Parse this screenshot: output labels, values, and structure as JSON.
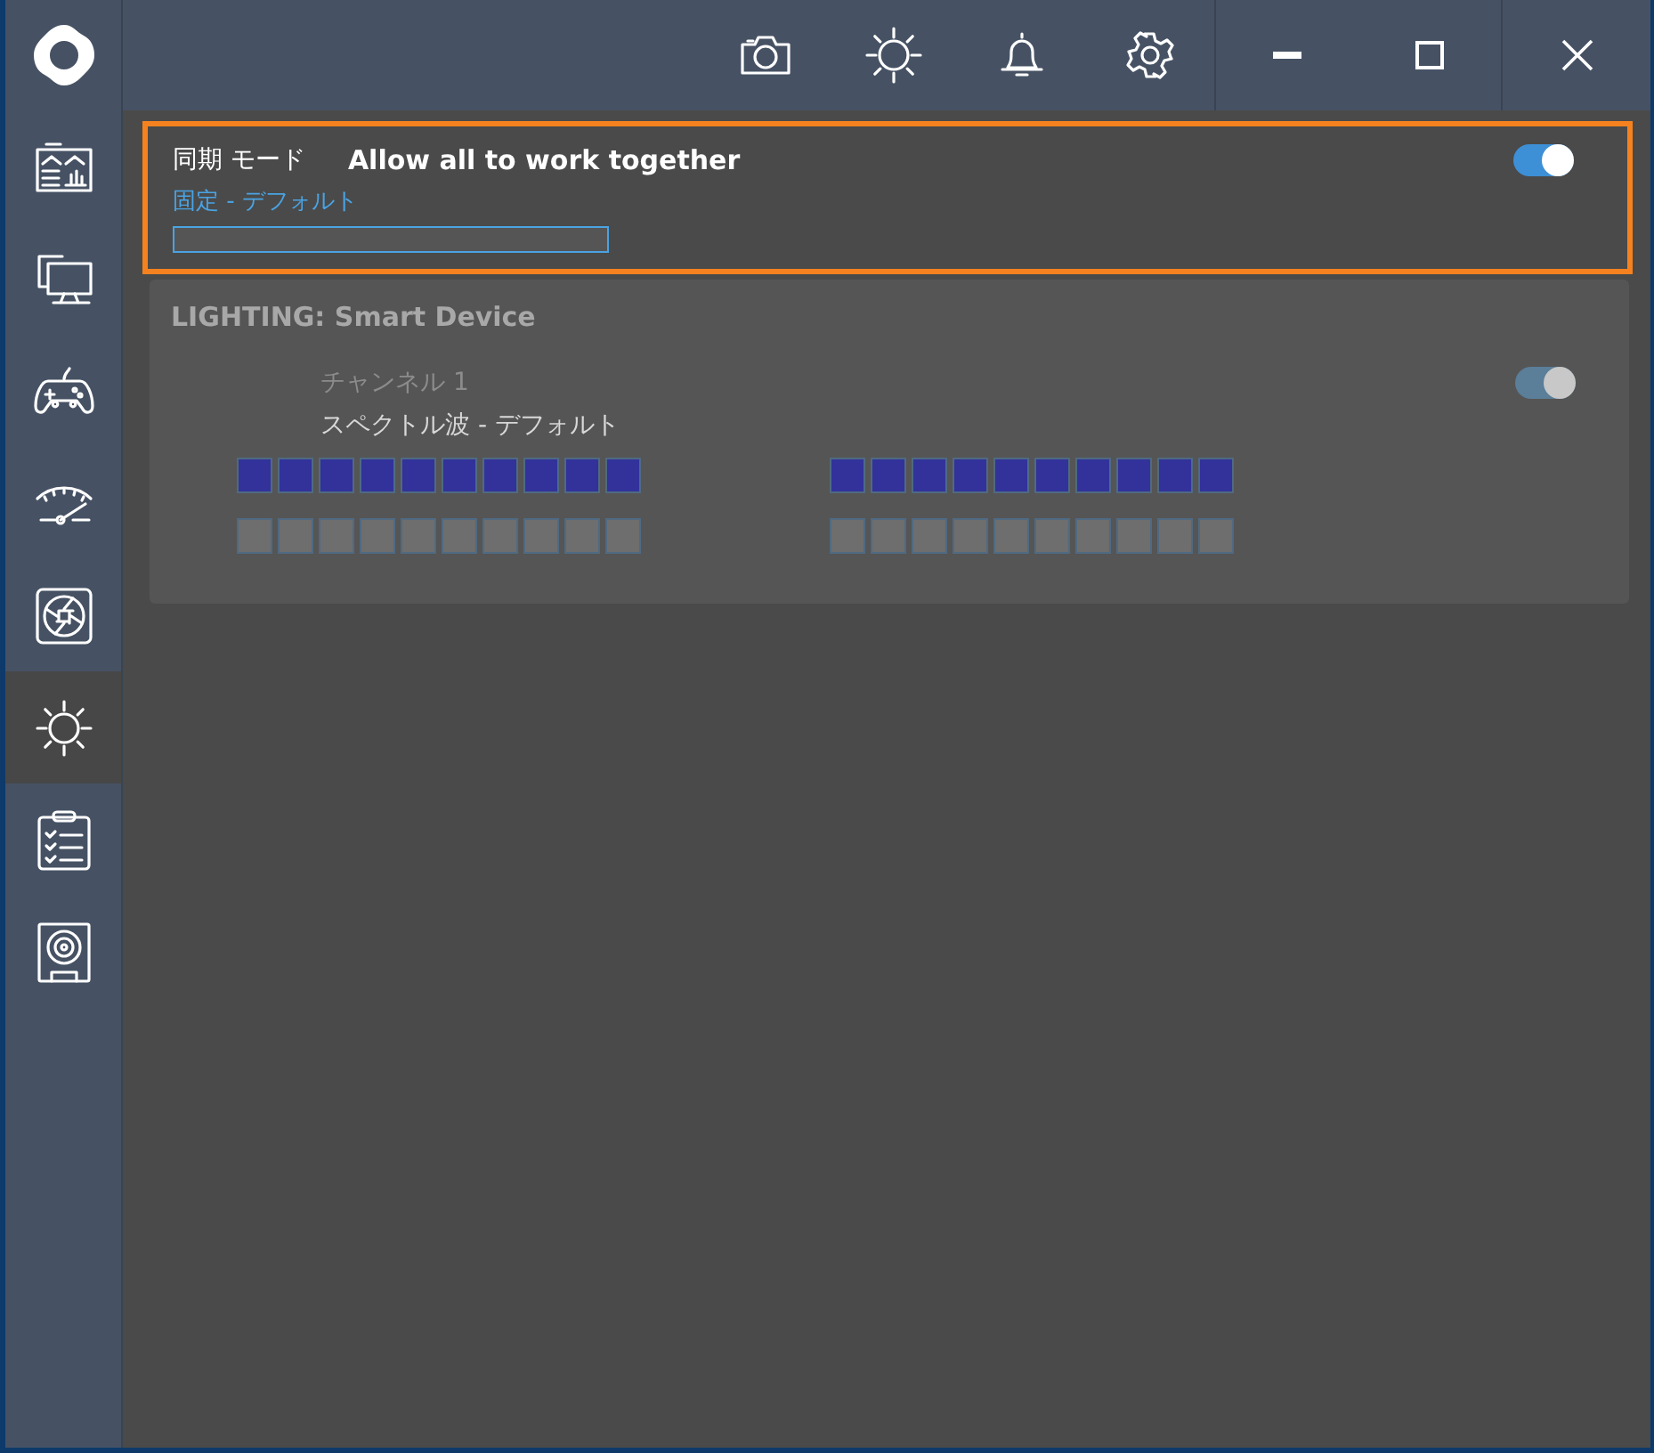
{
  "sidebar": {
    "items": [
      {
        "kind": "dashboard",
        "selected": false
      },
      {
        "kind": "monitor",
        "selected": false
      },
      {
        "kind": "gamepad",
        "selected": false
      },
      {
        "kind": "gauge",
        "selected": false
      },
      {
        "kind": "fan",
        "selected": false
      },
      {
        "kind": "sun",
        "selected": true
      },
      {
        "kind": "checklist",
        "selected": false
      },
      {
        "kind": "speaker",
        "selected": false
      }
    ]
  },
  "toolbar": {
    "items": [
      {
        "kind": "camera"
      },
      {
        "kind": "sun"
      },
      {
        "kind": "bell"
      },
      {
        "kind": "settings"
      }
    ]
  },
  "sync_mode": {
    "label": "同期 モード",
    "title": "Allow all to work together",
    "on": true,
    "mode": "固定 - デフォルト",
    "level": 0,
    "highlighted": true
  },
  "device": {
    "title": "LIGHTING: Smart Device",
    "disabled": true,
    "channel": {
      "label": "チャンネル 1",
      "on": true,
      "effect": "スペクトル波 - デフォルト",
      "zones": [
        {
          "top": [
            {
              "color": "#32329a"
            },
            {
              "color": "#32329a"
            },
            {
              "color": "#32329a"
            },
            {
              "color": "#32329a"
            },
            {
              "color": "#32329a"
            },
            {
              "color": "#32329a"
            },
            {
              "color": "#32329a"
            },
            {
              "color": "#32329a"
            },
            {
              "color": "#32329a"
            },
            {
              "color": "#32329a"
            }
          ],
          "bottom": [
            {
              "color": "#6e6e6e"
            },
            {
              "color": "#6e6e6e"
            },
            {
              "color": "#6e6e6e"
            },
            {
              "color": "#6e6e6e"
            },
            {
              "color": "#6e6e6e"
            },
            {
              "color": "#6e6e6e"
            },
            {
              "color": "#6e6e6e"
            },
            {
              "color": "#6e6e6e"
            },
            {
              "color": "#6e6e6e"
            },
            {
              "color": "#6e6e6e"
            }
          ]
        },
        {
          "top": [
            {
              "color": "#32329a"
            },
            {
              "color": "#32329a"
            },
            {
              "color": "#32329a"
            },
            {
              "color": "#32329a"
            },
            {
              "color": "#32329a"
            },
            {
              "color": "#32329a"
            },
            {
              "color": "#32329a"
            },
            {
              "color": "#32329a"
            },
            {
              "color": "#32329a"
            },
            {
              "color": "#32329a"
            }
          ],
          "bottom": [
            {
              "color": "#6e6e6e"
            },
            {
              "color": "#6e6e6e"
            },
            {
              "color": "#6e6e6e"
            },
            {
              "color": "#6e6e6e"
            },
            {
              "color": "#6e6e6e"
            },
            {
              "color": "#6e6e6e"
            },
            {
              "color": "#6e6e6e"
            },
            {
              "color": "#6e6e6e"
            },
            {
              "color": "#6e6e6e"
            },
            {
              "color": "#6e6e6e"
            }
          ]
        }
      ]
    }
  }
}
